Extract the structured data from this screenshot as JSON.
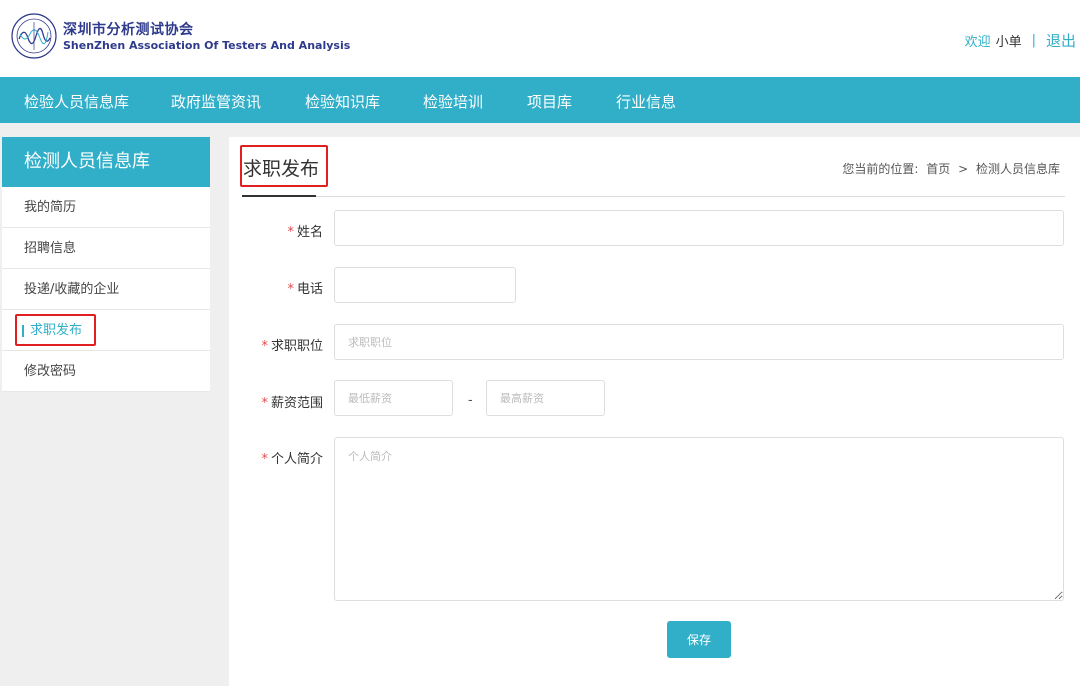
{
  "header": {
    "brand_cn": "深圳市分析测试协会",
    "brand_en": "ShenZhen Association Of Testers And Analysis",
    "welcome": "欢迎",
    "username": "小单",
    "separator": "|",
    "logout": "退出"
  },
  "nav": {
    "items": [
      "检验人员信息库",
      "政府监管资讯",
      "检验知识库",
      "检验培训",
      "项目库",
      "行业信息"
    ]
  },
  "sidebar": {
    "title": "检测人员信息库",
    "items": [
      "我的简历",
      "招聘信息",
      "投递/收藏的企业",
      "求职发布",
      "修改密码"
    ]
  },
  "main": {
    "title": "求职发布",
    "breadcrumb": {
      "prefix": "您当前的位置:",
      "home": "首页",
      "arrow": ">",
      "current": "检测人员信息库"
    },
    "form": {
      "required_mark": "*",
      "name_label": "姓名",
      "phone_label": "电话",
      "position_label": "求职职位",
      "position_placeholder": "求职职位",
      "salary_label": "薪资范围",
      "salary_min_placeholder": "最低薪资",
      "salary_dash": "-",
      "salary_max_placeholder": "最高薪资",
      "intro_label": "个人简介",
      "intro_placeholder": "个人简介",
      "save_label": "保存"
    }
  },
  "colors": {
    "accent": "#31afc9",
    "highlight": "#e02020",
    "required": "#e24a4a"
  }
}
